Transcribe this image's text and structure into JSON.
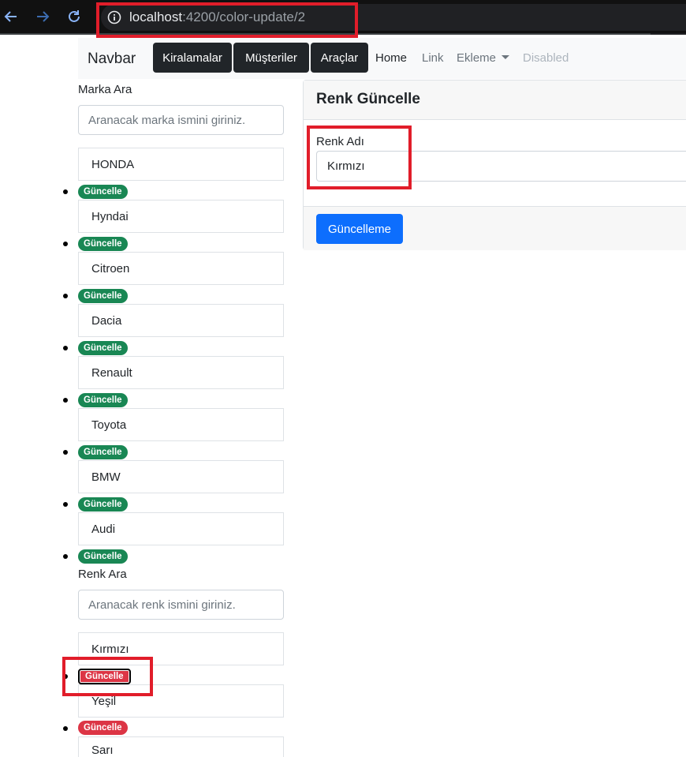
{
  "browser": {
    "url_host": "localhost",
    "url_rest": ":4200/color-update/2"
  },
  "navbar": {
    "brand": "Navbar",
    "buttons": [
      "Kiralamalar",
      "Müşteriler",
      "Araçlar"
    ],
    "links": [
      "Home",
      "Link",
      "Ekleme",
      "Disabled"
    ]
  },
  "brand_section": {
    "label": "Marka Ara",
    "placeholder": "Aranacak marka ismini giriniz.",
    "items": [
      "HONDA",
      "Hyndai",
      "Citroen",
      "Dacia",
      "Renault",
      "Toyota",
      "BMW",
      "Audi"
    ],
    "badge": "Güncelle"
  },
  "color_section": {
    "label": "Renk Ara",
    "placeholder": "Aranacak renk ismini giriniz.",
    "items": [
      "Kırmızı",
      "Yeşil",
      "Sarı"
    ],
    "badge": "Güncelle"
  },
  "card": {
    "title": "Renk Güncelle",
    "field_label": "Renk Adı",
    "field_value": "Kırmızı",
    "submit": "Güncelleme"
  },
  "colors": {
    "primary": "#0d6efd",
    "success": "#198754",
    "danger": "#dc3545",
    "dark": "#212529",
    "annotation": "#e11d2a"
  }
}
